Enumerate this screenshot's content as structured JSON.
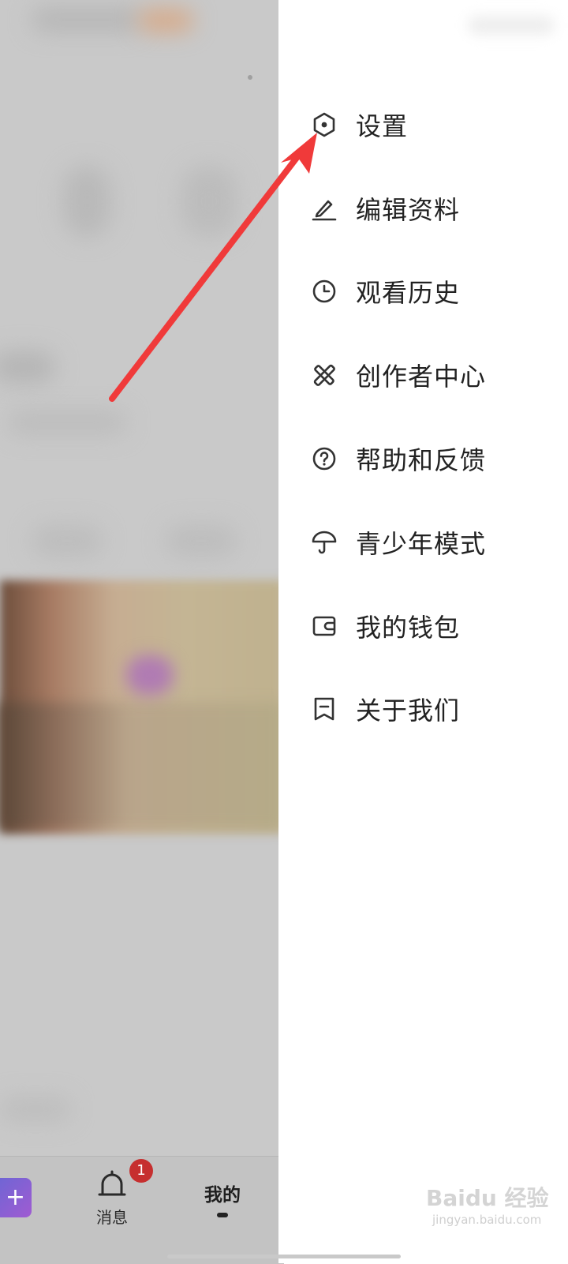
{
  "drawer": {
    "items": [
      {
        "label": "设置",
        "icon": "settings-hex-icon"
      },
      {
        "label": "编辑资料",
        "icon": "edit-pen-icon"
      },
      {
        "label": "观看历史",
        "icon": "clock-icon"
      },
      {
        "label": "创作者中心",
        "icon": "creator-tools-icon"
      },
      {
        "label": "帮助和反馈",
        "icon": "help-question-icon"
      },
      {
        "label": "青少年模式",
        "icon": "umbrella-icon"
      },
      {
        "label": "我的钱包",
        "icon": "wallet-icon"
      },
      {
        "label": "关于我们",
        "icon": "about-bookmark-icon"
      }
    ]
  },
  "bottom_nav": {
    "plus_label": "+",
    "messages_label": "消息",
    "messages_badge": "1",
    "me_label": "我的"
  },
  "watermark": {
    "main": "Baidu 经验",
    "sub": "jingyan.baidu.com"
  },
  "colors": {
    "annotation_arrow": "#f03a3a",
    "badge": "#c62f2f",
    "overlay": "#c9c9c9"
  }
}
